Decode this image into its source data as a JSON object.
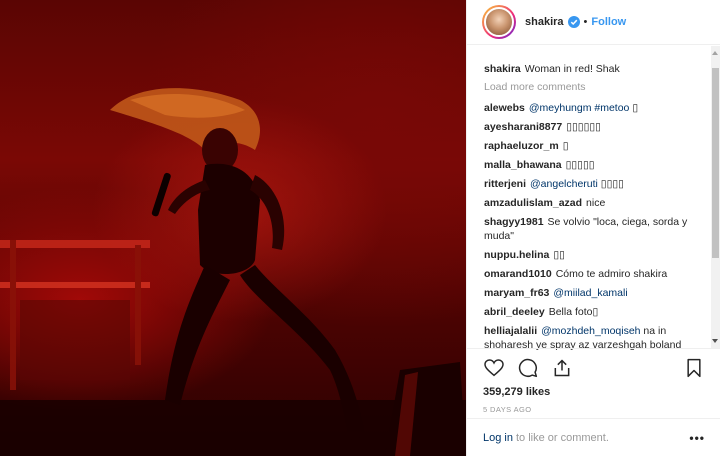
{
  "post": {
    "image_alt": "Performer on stage in red light"
  },
  "header": {
    "username": "shakira",
    "separator": "•",
    "follow_label": "Follow"
  },
  "comments": {
    "caption": {
      "user": "shakira",
      "text": "Woman in red! Shak"
    },
    "load_more": "Load more comments",
    "items": [
      {
        "user": "alewebs",
        "mention": "@meyhungm #metoo",
        "text": " ▯"
      },
      {
        "user": "ayesharani8877",
        "mention": "",
        "text": "▯▯▯▯▯▯"
      },
      {
        "user": "raphaeluzor_m",
        "mention": "",
        "text": "▯"
      },
      {
        "user": "malla_bhawana",
        "mention": "",
        "text": "▯▯▯▯▯"
      },
      {
        "user": "ritterjeni",
        "mention": "@angelcheruti",
        "text": " ▯▯▯▯"
      },
      {
        "user": "amzadulislam_azad",
        "mention": "",
        "text": "nice"
      },
      {
        "user": "shagyy1981",
        "mention": "",
        "text": "Se volvio \"loca, ciega, sorda y muda\""
      },
      {
        "user": "nuppu.helina",
        "mention": "",
        "text": "▯▯"
      },
      {
        "user": "omarand1010",
        "mention": "",
        "text": "Cómo te admiro shakira"
      },
      {
        "user": "maryam_fr63",
        "mention": "@miilad_kamali",
        "text": ""
      },
      {
        "user": "abril_deeley",
        "mention": "",
        "text": "Bella foto▯"
      },
      {
        "user": "helliajalalii",
        "mention": "@mozhdeh_moqiseh",
        "text": " na in shoharesh ye spray az varzeshgah boland"
      }
    ]
  },
  "actions": {
    "likes": "359,279 likes",
    "time": "5 DAYS AGO"
  },
  "footer": {
    "login_label": "Log in",
    "login_rest": "to like or comment.",
    "more_label": "•••"
  },
  "icons": [
    "verified-icon",
    "heart-icon",
    "comment-icon",
    "share-icon",
    "bookmark-icon",
    "more-icon"
  ],
  "colors": {
    "link": "#3897f0",
    "mention": "#003569",
    "muted": "#999999",
    "text": "#262626",
    "photo_red": "#7a0805"
  }
}
